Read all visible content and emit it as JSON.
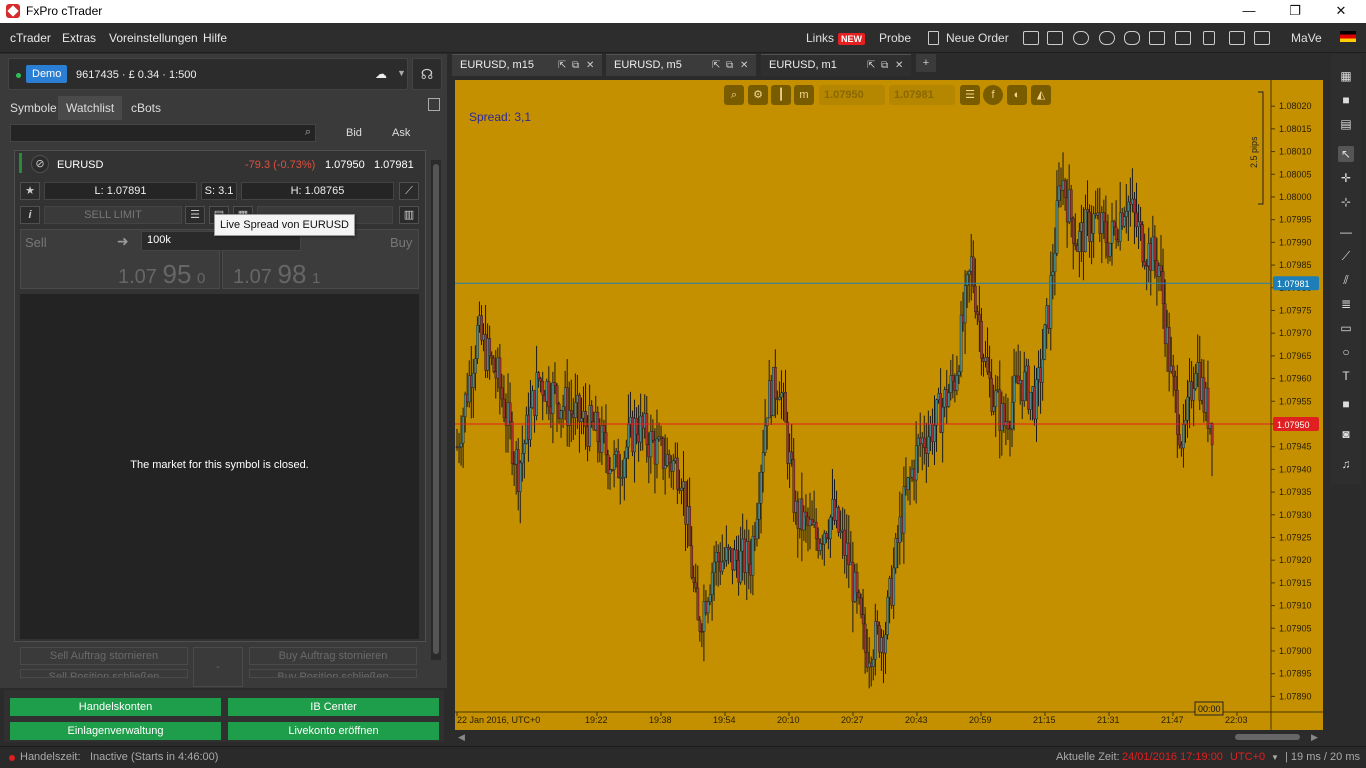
{
  "window": {
    "title": "FxPro cTrader",
    "controls": [
      "—",
      "❐",
      "✕"
    ]
  },
  "menu": {
    "items": [
      "cTrader",
      "Extras",
      "Voreinstellungen",
      "Hilfe"
    ]
  },
  "toolbar": {
    "links": "Links",
    "new_badge": "NEW",
    "probe": "Probe",
    "neue_order": "Neue Order",
    "user": "MaVe"
  },
  "account": {
    "badge": "Demo",
    "info": "9617435 · £ 0.34 · 1:500"
  },
  "left_tabs": [
    "Symbole",
    "Watchlist",
    "cBots"
  ],
  "watchlist": {
    "bid_header": "Bid",
    "ask_header": "Ask"
  },
  "symbol": {
    "name": "EURUSD",
    "change": "-79.3 (-0.73%)",
    "bid": "1.07950",
    "ask": "1.07981",
    "low": "L: 1.07891",
    "spread": "S: 3.1",
    "high": "H: 1.08765",
    "sell_limit": "SELL LIMIT",
    "sell_label": "Sell",
    "buy_label": "Buy",
    "volume": "100k",
    "sell_price": {
      "a": "1.07",
      "b": "95",
      "c": "0"
    },
    "buy_price": {
      "a": "1.07",
      "b": "98",
      "c": "1"
    },
    "closed_msg": "The market for this symbol is closed.",
    "tooltip": "Live Spread von EURUSD",
    "sell_cancel": "Sell Auftrag stornieren",
    "buy_cancel": "Buy Auftrag stornieren",
    "sell_close": "Sell Position schließen",
    "buy_close": "Buy Position schließen",
    "mid_dash": "-"
  },
  "bottom_buttons": [
    "Handelskonten",
    "IB Center",
    "Einlagenverwaltung",
    "Livekonto eröffnen"
  ],
  "chart_tabs": [
    "EURUSD, m15",
    "EURUSD, m5",
    "EURUSD, m1"
  ],
  "chart": {
    "spread_label": "Spread: 3,1",
    "pips_label": "2.5 pips",
    "bid_btn": "1.07950",
    "ask_btn": "1.07981",
    "bg_color": "#c49000",
    "bid_line_color": "#e02020",
    "ask_line_color": "#1e7fb8",
    "current_time_label": "00:00"
  },
  "chart_data": {
    "type": "candlestick",
    "title": "",
    "x_tick_labels": [
      "22 Jan 2016, UTC+0",
      "19:22",
      "19:38",
      "19:54",
      "20:10",
      "20:27",
      "20:43",
      "20:59",
      "21:15",
      "21:31",
      "21:47",
      "22:03"
    ],
    "y_tick_labels": [
      "1.08020",
      "1.08015",
      "1.08010",
      "1.08005",
      "1.08000",
      "1.07995",
      "1.07990",
      "1.07985",
      "1.07980",
      "1.07975",
      "1.07970",
      "1.07965",
      "1.07960",
      "1.07955",
      "1.07950",
      "1.07945",
      "1.07940",
      "1.07935",
      "1.07930",
      "1.07925",
      "1.07920",
      "1.07915",
      "1.07910",
      "1.07905",
      "1.07900",
      "1.07895",
      "1.07890"
    ],
    "ylim": [
      1.07887,
      1.08024
    ],
    "bid": 1.0795,
    "ask": 1.07981,
    "bid_label": "1.07950",
    "ask_label": "1.07981",
    "guide_points": [
      [
        0,
        1.07945
      ],
      [
        10,
        1.0797
      ],
      [
        20,
        1.0796
      ],
      [
        30,
        1.0794
      ],
      [
        40,
        1.0796
      ],
      [
        55,
        1.07953
      ],
      [
        68,
        1.07948
      ],
      [
        78,
        1.0794
      ],
      [
        88,
        1.0795
      ],
      [
        100,
        1.07943
      ],
      [
        110,
        1.0794
      ],
      [
        118,
        1.07905
      ],
      [
        126,
        1.0792
      ],
      [
        134,
        1.0792
      ],
      [
        144,
        1.0792
      ],
      [
        152,
        1.07955
      ],
      [
        158,
        1.0796
      ],
      [
        166,
        1.0793
      ],
      [
        176,
        1.07925
      ],
      [
        184,
        1.0793
      ],
      [
        192,
        1.0792
      ],
      [
        200,
        1.079
      ],
      [
        210,
        1.07905
      ],
      [
        218,
        1.0793
      ],
      [
        226,
        1.07945
      ],
      [
        234,
        1.0795
      ],
      [
        244,
        1.0796
      ],
      [
        252,
        1.07985
      ],
      [
        260,
        1.0796
      ],
      [
        268,
        1.0795
      ],
      [
        276,
        1.0796
      ],
      [
        284,
        1.07955
      ],
      [
        290,
        1.07975
      ],
      [
        296,
        1.08005
      ],
      [
        304,
        1.0799
      ],
      [
        312,
        1.07995
      ],
      [
        320,
        1.0799
      ],
      [
        328,
        1.08
      ],
      [
        336,
        1.0799
      ],
      [
        344,
        1.07985
      ],
      [
        350,
        1.0796
      ],
      [
        356,
        1.07945
      ],
      [
        362,
        1.07965
      ],
      [
        366,
        1.07955
      ],
      [
        370,
        1.0795
      ]
    ]
  },
  "status": {
    "trading_time_label": "Handelszeit:",
    "trading_time_value": "Inactive (Starts in 4:46:00)",
    "current_time_label": "Aktuelle Zeit:",
    "current_time_value": "24/01/2016 17:19:00",
    "timezone": "UTC+0",
    "latency": "| 19 ms / 20 ms"
  },
  "colors": {
    "accent": "#2a7fd4",
    "green": "#1e9e4a",
    "red": "#e02020"
  }
}
